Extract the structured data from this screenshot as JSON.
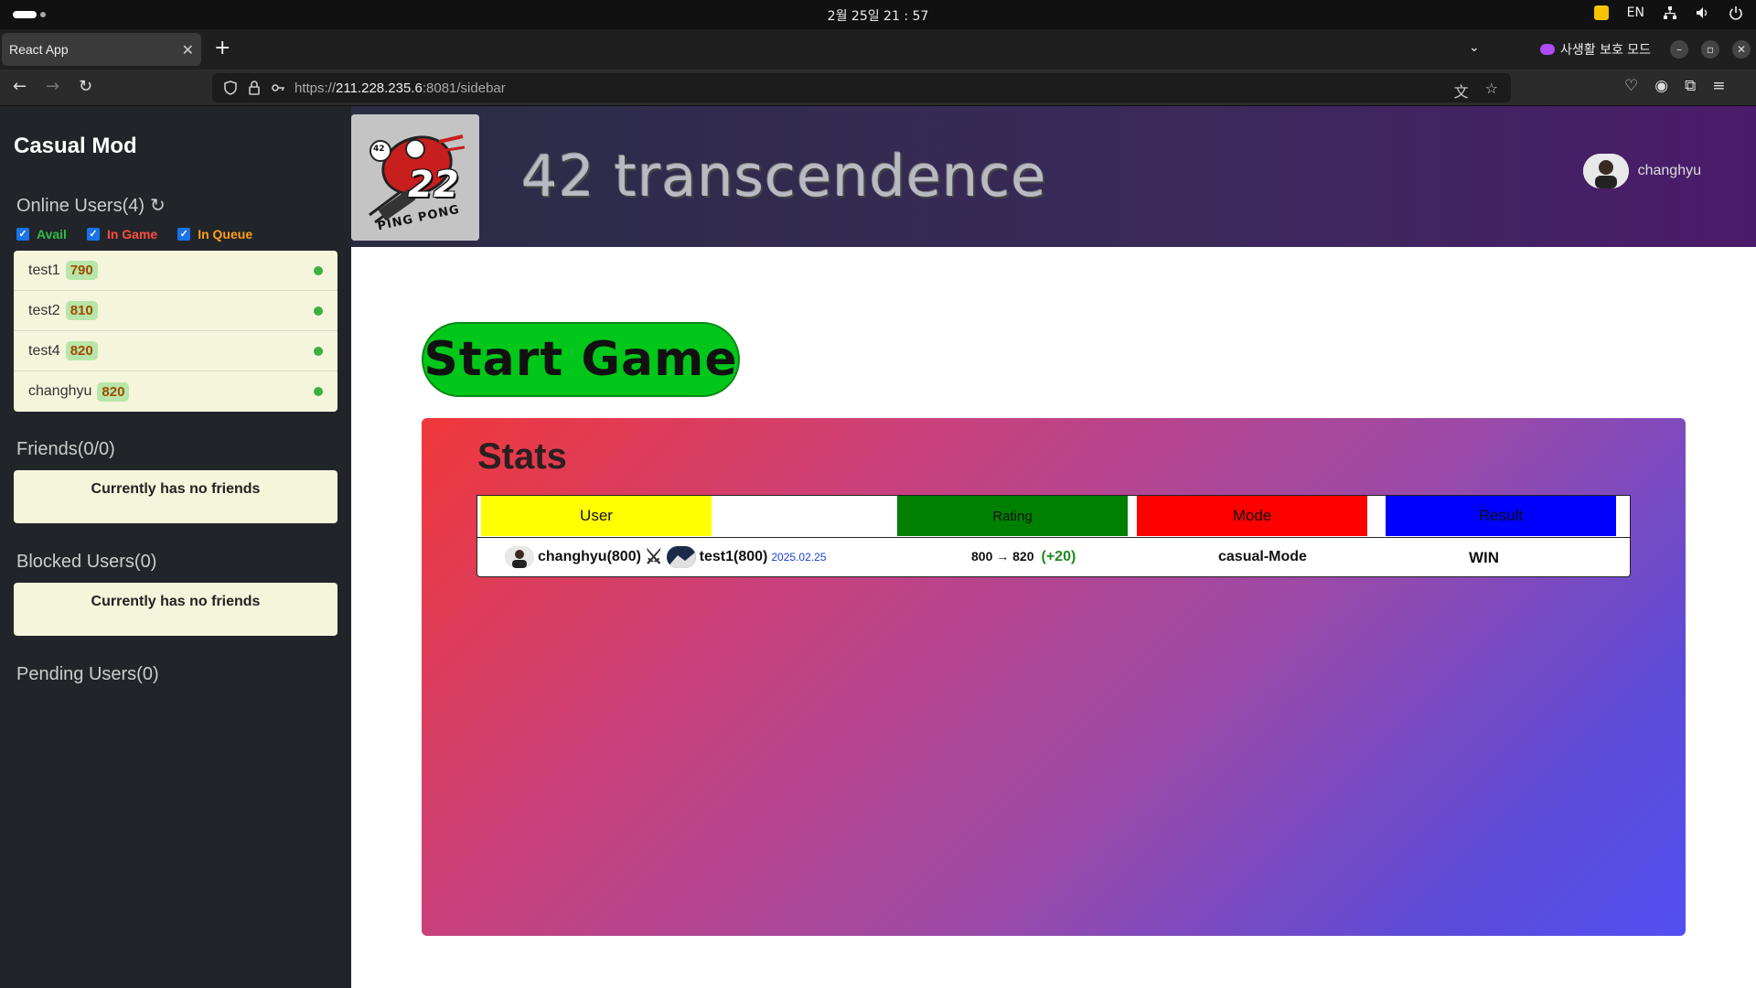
{
  "os": {
    "clock": "2월 25일  21 : 57",
    "lang": "EN"
  },
  "browser": {
    "tab_title": "React App",
    "private_label": "사생활 보호 모드",
    "url_prefix": "https://",
    "url_host": "211.228.235.6",
    "url_rest": ":8081/sidebar"
  },
  "sidebar": {
    "title": "Casual Mod",
    "online_label": "Online Users(4)",
    "filters": {
      "avail": "Avail",
      "in_game": "In Game",
      "in_queue": "In Queue"
    },
    "online_users": [
      {
        "name": "test1",
        "rating": "790"
      },
      {
        "name": "test2",
        "rating": "810"
      },
      {
        "name": "test4",
        "rating": "820"
      },
      {
        "name": "changhyu",
        "rating": "820"
      }
    ],
    "friends_label": "Friends(0/0)",
    "friends_empty": "Currently has no friends",
    "blocked_label": "Blocked Users(0)",
    "blocked_empty": "Currently has no friends",
    "pending_label": "Pending Users(0)"
  },
  "header": {
    "logo_badge": "42",
    "logo_number": "22",
    "logo_text": "PING PONG",
    "title": "42 transcendence",
    "username": "changhyu"
  },
  "main": {
    "start_button": "Start Game",
    "stats_title": "Stats",
    "columns": {
      "user": "User",
      "rating": "Rating",
      "mode": "Mode",
      "result": "Result"
    },
    "matches": [
      {
        "player1": "changhyu(800)",
        "player2": "test1(800)",
        "date": "2025.02.25",
        "rating_change": "800 → 820",
        "delta": "(+20)",
        "mode": "casual-Mode",
        "result": "WIN"
      }
    ]
  },
  "colors": {
    "start_button": "#00c71a",
    "user_header": "#ffff00",
    "rating_header": "#008000",
    "mode_header": "#ff0000",
    "result_header": "#0000ff"
  }
}
